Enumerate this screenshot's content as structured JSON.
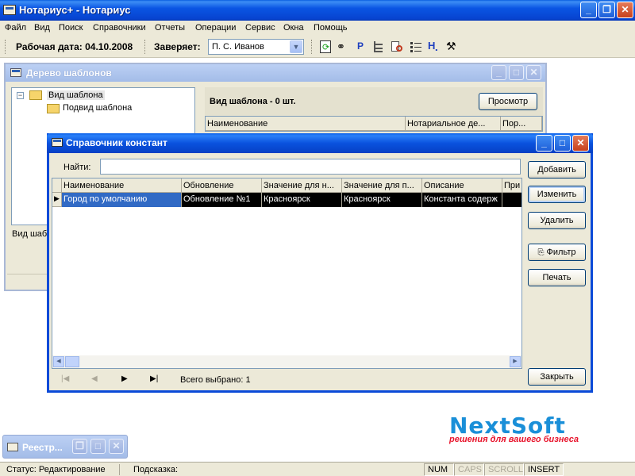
{
  "app": {
    "title": "Нотариус+ - Нотариус",
    "menu": [
      "Файл",
      "Вид",
      "Поиск",
      "Справочники",
      "Отчеты",
      "Операции",
      "Сервис",
      "Окна",
      "Помощь"
    ]
  },
  "toolbar": {
    "work_date": "Рабочая дата: 04.10.2008",
    "certifies_label": "Заверяет:",
    "certifies_value": "П. С. Иванов",
    "icons": [
      "refresh-icon",
      "binoculars-icon",
      "p-icon",
      "tree-icon",
      "search-doc-icon",
      "list-icon",
      "h-icon",
      "tools-icon"
    ],
    "h_glyph": "H",
    "p_glyph": "P"
  },
  "tree_window": {
    "title": "Дерево шаблонов",
    "tree_root": "Вид шаблона",
    "tree_child": "Подвид шаблона",
    "header": "Вид шаблона - 0 шт.",
    "view_button": "Просмотр",
    "columns": [
      "Наименование",
      "Нотариальное де...",
      "Пор..."
    ],
    "bottom_label": "Вид шаб"
  },
  "constants_window": {
    "title": "Справочник констант",
    "search_label": "Найти:",
    "search_value": "",
    "columns": [
      "Наименование",
      "Обновление",
      "Значение для н...",
      "Значение для п...",
      "Описание",
      "При"
    ],
    "rows": [
      [
        "Город по умолчанию",
        "Обновление №1",
        "Красноярск",
        "Красноярск",
        "Константа содерж",
        ""
      ]
    ],
    "buttons": {
      "add": "Добавить",
      "edit": "Изменить",
      "delete": "Удалить",
      "filter": "Фильтр",
      "print": "Печать",
      "close": "Закрыть"
    },
    "selected_count": "Всего выбрано: 1"
  },
  "minimized_window": {
    "title": "Реестр..."
  },
  "brand": {
    "name_part1": "Next",
    "name_part2": "Soft",
    "tagline": "решения для вашего бизнеса",
    "blue": "#1a8fd8",
    "red": "#e8132b"
  },
  "statusbar": {
    "status": "Статус: Редактирование",
    "hint": "Подсказка:",
    "num": "NUM",
    "caps": "CAPS",
    "scroll": "SCROLL",
    "insert": "INSERT"
  }
}
